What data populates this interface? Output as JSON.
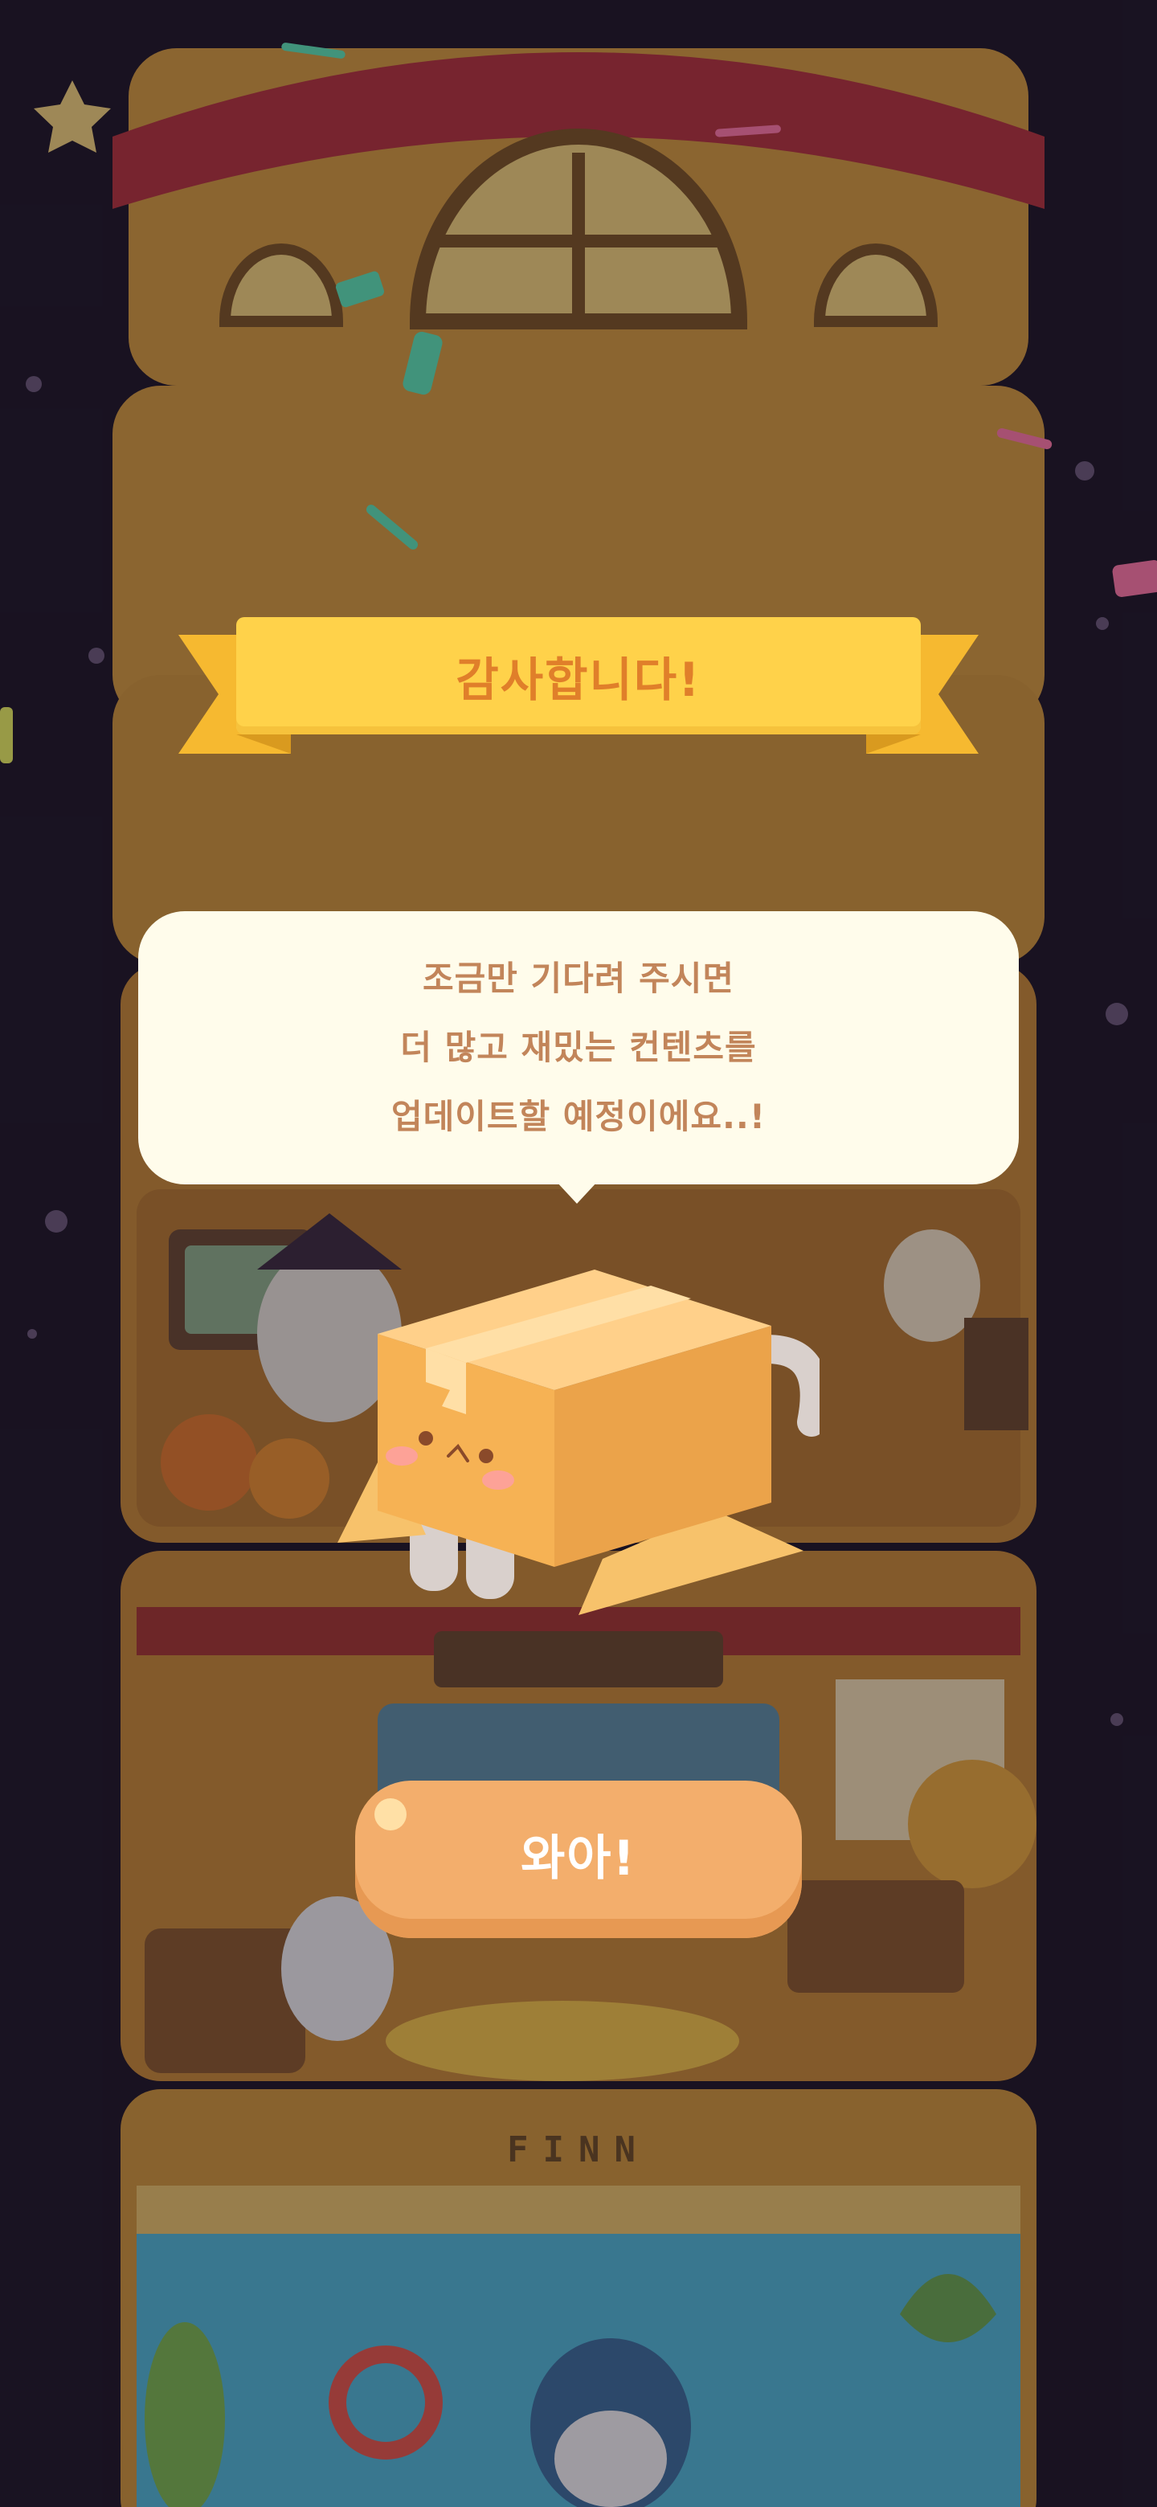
{
  "banner": {
    "title": "감사합니다!"
  },
  "message": {
    "lines": [
      "조금만 기다려 주시면",
      "더 많고 재밌는 컨텐츠를",
      "업데이트할 예정이에요..!"
    ]
  },
  "button": {
    "label": "와아!"
  },
  "background": {
    "sign_text": "FINN"
  },
  "colors": {
    "ribbon": "#ffd24a",
    "ribbon_text": "#e07f2a",
    "bubble": "#fffceb",
    "bubble_text": "#c2855a",
    "button": "#f3ae6c",
    "box": "#f5b35a",
    "night_sky": "#1c1625"
  },
  "icons": [
    "cardboard-box-cat-icon",
    "star-icon",
    "confetti-icon"
  ]
}
